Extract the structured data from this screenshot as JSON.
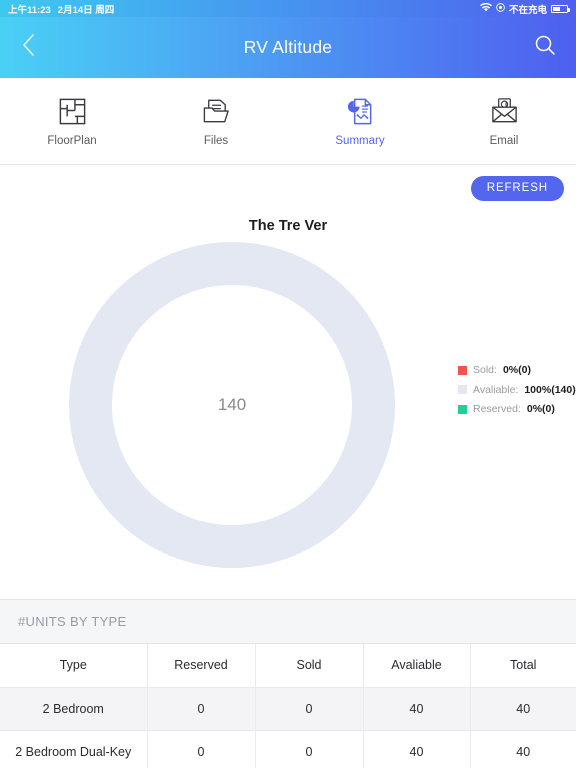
{
  "status_bar": {
    "time": "上午11:23",
    "date": "2月14日 周四",
    "wifi_icon": "wifi-icon",
    "location_icon": "location-icon",
    "battery_text": "不在充电",
    "battery_icon": "battery-icon"
  },
  "nav": {
    "back_icon": "chevron-left-icon",
    "title": "RV Altitude",
    "search_icon": "search-icon"
  },
  "tabs": [
    {
      "label": "FloorPlan",
      "icon": "floorplan-icon",
      "active": false
    },
    {
      "label": "Files",
      "icon": "files-icon",
      "active": false
    },
    {
      "label": "Summary",
      "icon": "summary-icon",
      "active": true
    },
    {
      "label": "Email",
      "icon": "email-icon",
      "active": false
    }
  ],
  "toolbar": {
    "refresh_label": "REFRESH"
  },
  "chart_data": {
    "type": "pie",
    "title": "The Tre Ver",
    "center_label": "140",
    "total": 140,
    "legend_position": "right",
    "slices": [
      {
        "name": "Sold",
        "label": "Sold:",
        "value": 0,
        "percent": 0,
        "display": "0%(0)",
        "color": "#f1544a"
      },
      {
        "name": "Avaliable",
        "label": "Avaliable:",
        "value": 140,
        "percent": 100,
        "display": "100%(140)",
        "color": "#e3e8f2"
      },
      {
        "name": "Reserved",
        "label": "Reserved:",
        "value": 0,
        "percent": 0,
        "display": "0%(0)",
        "color": "#21d094"
      }
    ]
  },
  "table": {
    "heading": "#UNITS BY TYPE",
    "columns": [
      "Type",
      "Reserved",
      "Sold",
      "Avaliable",
      "Total"
    ],
    "rows": [
      {
        "type": "2 Bedroom",
        "reserved": "0",
        "sold": "0",
        "avaliable": "40",
        "total": "40"
      },
      {
        "type": "2 Bedroom Dual-Key",
        "reserved": "0",
        "sold": "0",
        "avaliable": "40",
        "total": "40"
      }
    ]
  },
  "colors": {
    "brand_start": "#4ad0f5",
    "brand_end": "#4e5ff0",
    "accent": "#5566ee",
    "sold": "#f1544a",
    "available": "#e3e8f2",
    "reserved": "#21d094"
  }
}
